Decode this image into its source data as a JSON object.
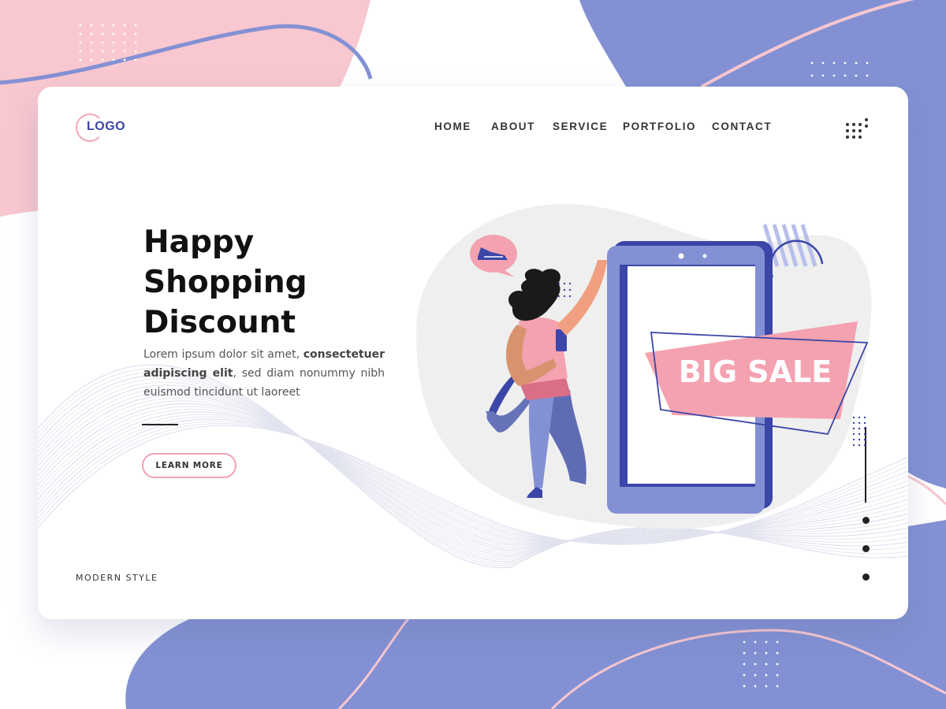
{
  "header": {
    "logo_text": "LOGO",
    "nav": [
      "HOME",
      "ABOUT",
      "SERVICE",
      "PORTFOLIO",
      "CONTACT"
    ]
  },
  "hero": {
    "title_lines": [
      "Happy",
      "Shopping",
      "Discount"
    ],
    "paragraph": {
      "part1": "Lorem ipsum dolor sit amet, ",
      "bold1": "consectetuer adipiscing elit",
      "part2": ", sed diam nonummy nibh euismod tincidunt ut laoreet"
    },
    "button_label": "LEARN MORE"
  },
  "footer": {
    "style_label": "MODERN STYLE"
  },
  "illustration": {
    "sale_text": "BIG SALE"
  },
  "pager": {
    "count": 3
  },
  "colors": {
    "pink": "#f8c7cf",
    "pink_accent": "#f2a3b3",
    "blue": "#8391d4",
    "navy": "#3b46a8",
    "sale_pink": "#f4a2b0"
  }
}
